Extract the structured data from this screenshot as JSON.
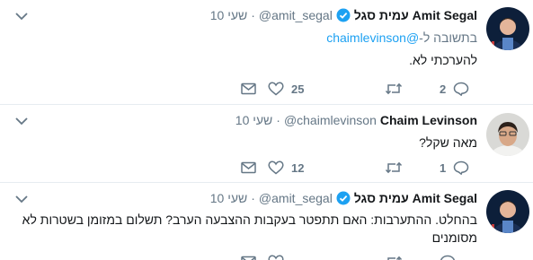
{
  "tweets": [
    {
      "name": "עמית סגל Amit Segal",
      "handle": "@amit_segal",
      "time": "10 שעי",
      "reply_prefix": "בתשובה ל-",
      "reply_handle": "@chaimlevinson",
      "text": "להערכתי לא.",
      "likes": "25",
      "replies": "2"
    },
    {
      "name": "Chaim Levinson",
      "handle": "@chaimlevinson",
      "time": "10 שעי",
      "text": "מאה שקל?",
      "likes": "12",
      "replies": "1"
    },
    {
      "name": "עמית סגל Amit Segal",
      "handle": "@amit_segal",
      "time": "10 שעי",
      "text": "בהחלט. ההתערבות: האם תתפטר בעקבות ההצבעה הערב? תשלום במזומן בשטרות לא מסומנים"
    }
  ],
  "separator": "·",
  "colors": {
    "accent": "#1da1f2",
    "muted": "#657786",
    "text": "#14171a"
  },
  "icons": [
    "chevron-down-icon",
    "verified-badge-icon",
    "direct-message-icon",
    "heart-icon",
    "retweet-icon",
    "reply-icon"
  ]
}
